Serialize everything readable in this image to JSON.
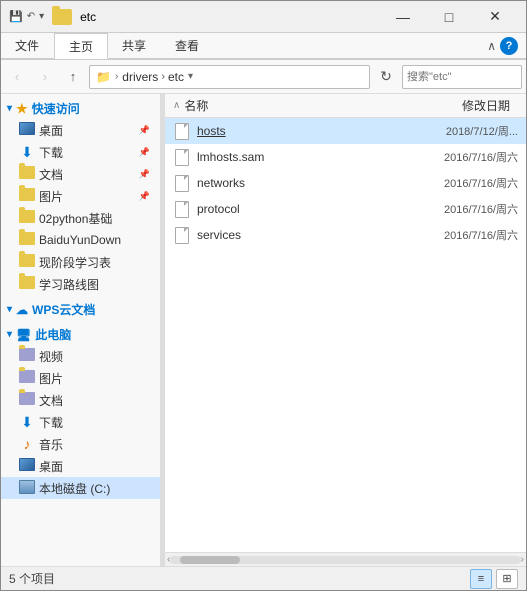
{
  "window": {
    "title": "etc",
    "folder_icon": "folder"
  },
  "titlebar": {
    "quick_access_icons": [
      "back",
      "forward",
      "up"
    ],
    "title": "etc",
    "minimize": "—",
    "maximize": "□",
    "close": "✕"
  },
  "ribbon": {
    "tabs": [
      "文件",
      "主页",
      "共享",
      "查看"
    ],
    "active_tab": "主页",
    "help_icon": "?"
  },
  "addressbar": {
    "back": "‹",
    "forward": "›",
    "up": "↑",
    "path_segments": [
      "drivers",
      "etc"
    ],
    "search_placeholder": "搜索\"etc\"",
    "dropdown_arrow": "▾",
    "refresh": "↻"
  },
  "sidebar": {
    "quick_access_label": "快速访问",
    "items": [
      {
        "label": "桌面",
        "type": "desktop",
        "pinned": true
      },
      {
        "label": "下载",
        "type": "download",
        "pinned": true
      },
      {
        "label": "文档",
        "type": "document",
        "pinned": true
      },
      {
        "label": "图片",
        "type": "picture",
        "pinned": true
      },
      {
        "label": "02python基础",
        "type": "folder"
      },
      {
        "label": "BaiduYunDown",
        "type": "folder"
      },
      {
        "label": "现阶段学习表",
        "type": "folder"
      },
      {
        "label": "学习路线图",
        "type": "folder"
      }
    ],
    "cloud_label": "WPS云文档",
    "computer_label": "此电脑",
    "computer_items": [
      {
        "label": "视频",
        "type": "folder_special"
      },
      {
        "label": "图片",
        "type": "folder_special"
      },
      {
        "label": "文档",
        "type": "folder_special"
      },
      {
        "label": "下载",
        "type": "download"
      },
      {
        "label": "音乐",
        "type": "music"
      },
      {
        "label": "桌面",
        "type": "desktop"
      }
    ],
    "drives": [
      {
        "label": "本地磁盘 (C:)",
        "type": "drive",
        "active": true
      }
    ]
  },
  "filelist": {
    "columns": {
      "name": "名称",
      "date": "修改日期"
    },
    "files": [
      {
        "name": "hosts",
        "date": "2018/7/12/周...",
        "selected": true,
        "underline": true
      },
      {
        "name": "lmhosts.sam",
        "date": "2016/7/16/周六"
      },
      {
        "name": "networks",
        "date": "2016/7/16/周六"
      },
      {
        "name": "protocol",
        "date": "2016/7/16/周六"
      },
      {
        "name": "services",
        "date": "2016/7/16/周六"
      }
    ]
  },
  "statusbar": {
    "count": "5 个项目",
    "view_list": "≡",
    "view_large": "⊞"
  }
}
